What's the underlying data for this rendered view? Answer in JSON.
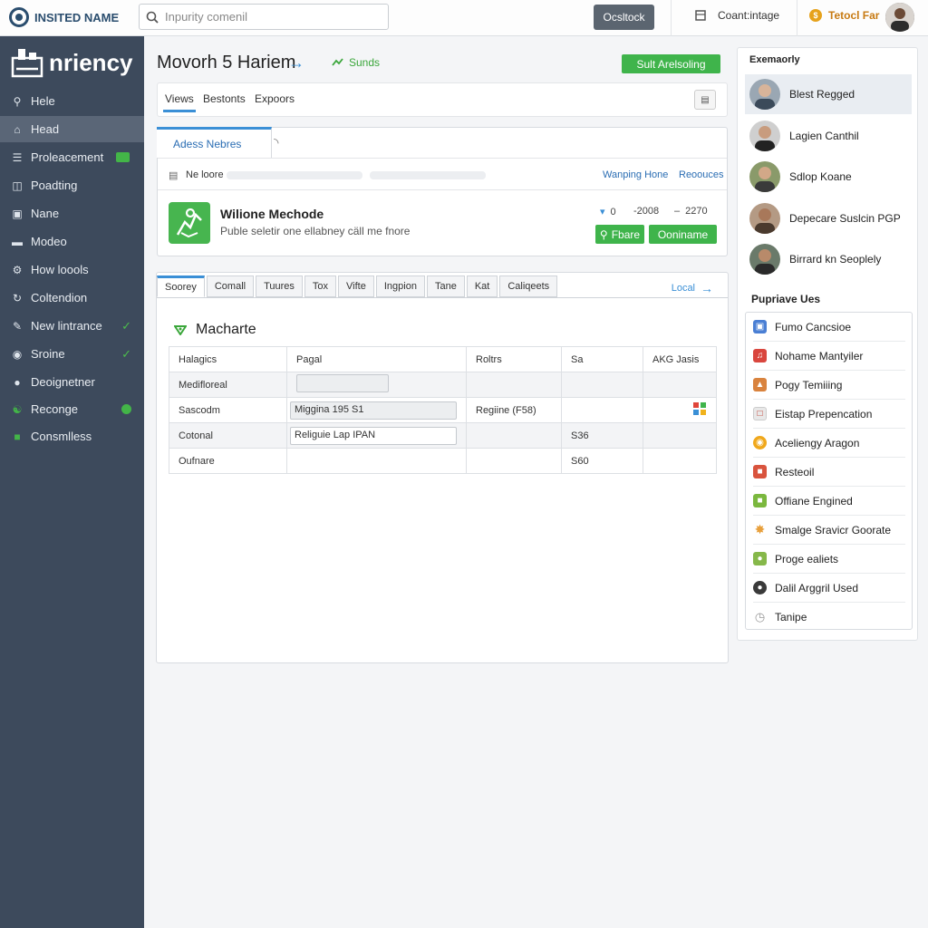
{
  "topbar": {
    "brand": "INSITED NAME",
    "search_placeholder": "Inpurity comenil",
    "button_label": "Ocsltock",
    "link_label": "Coant:intage",
    "user_label": "Tetocl Far"
  },
  "sidebar": {
    "logo_text": "nriency",
    "items": [
      {
        "label": "Hele"
      },
      {
        "label": "Head"
      },
      {
        "label": "Proleacement"
      },
      {
        "label": "Poadting"
      },
      {
        "label": "Nane"
      },
      {
        "label": "Modeo"
      },
      {
        "label": "How loools"
      },
      {
        "label": "Coltendion"
      },
      {
        "label": "New lintrance"
      },
      {
        "label": "Sroine"
      },
      {
        "label": "Deoignetner"
      },
      {
        "label": "Recongе"
      },
      {
        "label": "Consmlless"
      }
    ]
  },
  "main": {
    "title": "Movorh 5 Hariem",
    "title_tag": "Sunds",
    "primary_button": "Sult Arelsoling",
    "tabs": [
      "Views",
      "Bestonts",
      "Expoors"
    ],
    "detail": {
      "tab_label": "Adess Nebres",
      "sub_label": "Ne loore",
      "link1": "Wanping Hone",
      "link2": "Reoouces",
      "app_name": "Wilione Mechode",
      "app_desc": "Puble seletir one ellabney cäll me fnore",
      "stat1": "0",
      "stat2": "-2008",
      "stat3": "2270",
      "btn_share": "Fbare",
      "btn_continue": "Ooniname"
    },
    "grid": {
      "tabs": [
        "Soorey",
        "Comall",
        "Tuures",
        "Tox",
        "Vifte",
        "Ingpion",
        "Tane",
        "Kat",
        "Caliqeets"
      ],
      "local_link": "Local",
      "section_title": "Macharte",
      "headers": [
        "Halagics",
        "Pagal",
        "Roltrs",
        "Sa",
        "AKG Jasis"
      ],
      "rows": [
        {
          "c1": "Medifloreal"
        },
        {
          "c1": "Sascodm",
          "c2": "Miggina 195 S1",
          "c3": "Regiine (F58)"
        },
        {
          "c1": "Cotonal",
          "c2": "Religuie Lap IPAN",
          "c4": "S36"
        },
        {
          "c1": "Oufnare",
          "c4": "S60"
        }
      ]
    }
  },
  "right": {
    "title": "Exemaorly",
    "people": [
      "Blest Regged",
      "Lagien Canthil",
      "Sdlop Koane",
      "Depecare Suslcin PGP",
      "Birrard kn Seoplely"
    ],
    "apps_title": "Pupriave Ues",
    "apps": [
      {
        "label": "Fumo Cancsioe",
        "color": "#4a7fd4",
        "icon": "doc-icon"
      },
      {
        "label": "Nohame Mantyiler",
        "color": "#d9463e",
        "icon": "music-icon"
      },
      {
        "label": "Pogy Temiiing",
        "color": "#d9833e",
        "icon": "image-icon"
      },
      {
        "label": "Eistap Prepencation",
        "color": "#e0e0e0",
        "icon": "page-icon"
      },
      {
        "label": "Aceliengy Aragon",
        "color": "#f0a81c",
        "icon": "chrome-icon"
      },
      {
        "label": "Resteoil",
        "color": "#d9543e",
        "icon": "box-icon"
      },
      {
        "label": "Offiane Engined",
        "color": "#7bb83e",
        "icon": "square-icon"
      },
      {
        "label": "Smalge Sravicr Goorate",
        "color": "#e8a03c",
        "icon": "star-icon"
      },
      {
        "label": "Proge ealiets",
        "color": "#86b84a",
        "icon": "leaf-icon"
      },
      {
        "label": "Dalil Arggril Used",
        "color": "#3a3a3a",
        "icon": "apple-icon"
      },
      {
        "label": "Tanipe",
        "color": "#999999",
        "icon": "clock-icon"
      }
    ]
  },
  "colors": {
    "sidebar_bg": "#3d4a5c",
    "accent_blue": "#3a8fd6",
    "accent_green": "#3fb44b"
  }
}
